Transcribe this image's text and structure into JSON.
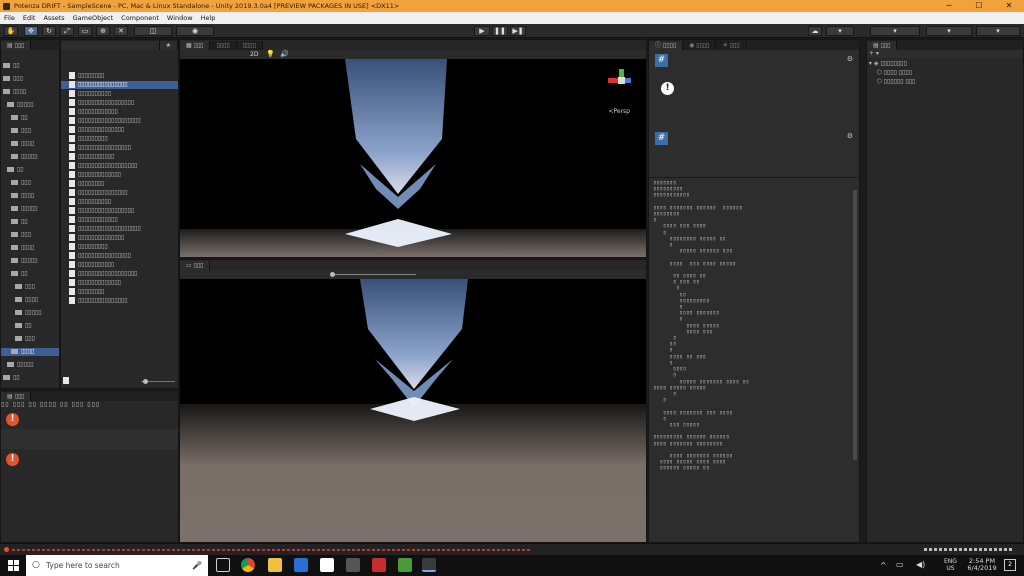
{
  "window": {
    "title": "Potenza DRIFT - SampleScene - PC, Mac & Linux Standalone - Unity 2019.3.0a4 [PREVIEW PACKAGES IN USE] <DX11>",
    "controls": [
      "─",
      "☐",
      "✕"
    ]
  },
  "menu": [
    "File",
    "Edit",
    "Assets",
    "GameObject",
    "Component",
    "Window",
    "Help"
  ],
  "toolbar": {
    "play": "▶",
    "pause": "❚❚",
    "step": "▶❚"
  },
  "scene_view": {
    "mode_2d": "2D",
    "gizmo_label": "<Persp"
  },
  "inspector": {
    "error_mark": "!",
    "script_mark": "#"
  },
  "taskbar": {
    "search_placeholder": "Type here to search",
    "language": "ENG",
    "region": "US",
    "time": "2:54 PM",
    "date": "6/4/2019",
    "notifications": "2"
  },
  "colors": {
    "titlebar": "#f1a23d",
    "error": "#e5532b",
    "selection": "#3e5f96",
    "panel": "#282828"
  }
}
